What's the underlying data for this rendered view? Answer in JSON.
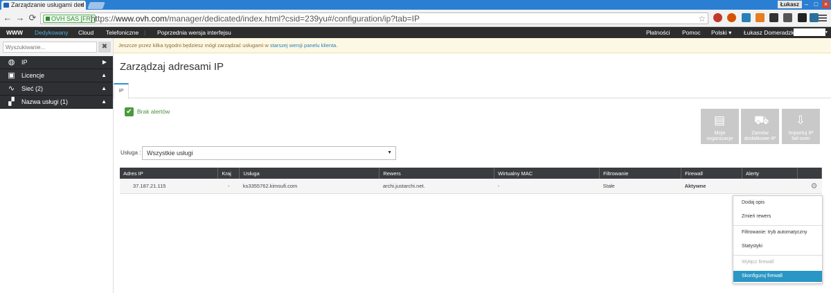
{
  "browser": {
    "tab_title": "Zarządzanie usługami ded",
    "tab_close": "×",
    "user_badge": "Łukasz",
    "ev_label": "OVH SAS [FR]",
    "url_scheme": "https://",
    "url_host": "www.ovh.com",
    "url_path": "/manager/dedicated/index.html?csid=239yu#/configuration/ip?tab=IP"
  },
  "topnav": {
    "www": "WWW",
    "dedicated": "Dedykowany",
    "cloud": "Cloud",
    "telephony": "Telefoniczne",
    "prev_version": "Poprzednia wersja interfejsu",
    "payments": "Płatności",
    "help": "Pomoc",
    "language": "Polski",
    "user": "Łukasz Domeradzki"
  },
  "sidebar": {
    "search_placeholder": "Wyszukiwanie...",
    "items": [
      {
        "label": "IP"
      },
      {
        "label": "Licencje"
      },
      {
        "label": "Sieć (2)"
      },
      {
        "label": "Nazwa usługi (1)"
      }
    ]
  },
  "notice": {
    "text": "Jeszcze przez kilka tygodni będziesz mógł zarządzać usługami w",
    "link": "starszej wersji panelu klienta."
  },
  "main": {
    "title": "Zarządzaj adresami IP",
    "tab": "IP",
    "alerts_label": "Brak alertów",
    "tiles": [
      {
        "line1": "Moje",
        "line2": "organizacje",
        "icon": "clipboard-icon"
      },
      {
        "line1": "Zamów",
        "line2": "dodatkowe IP",
        "icon": "cart-icon"
      },
      {
        "line1": "Importuj IP",
        "line2": "fail-over",
        "icon": "import-icon"
      }
    ],
    "service_label": "Usługa :",
    "service_value": "Wszystkie usługi"
  },
  "table": {
    "headers": [
      "Adres IP",
      "Kraj",
      "Usługa",
      "Rewers",
      "Wirtualny MAC",
      "Filtrowanie",
      "Firewall",
      "Alerty"
    ],
    "rows": [
      [
        "37.187.21.115",
        "-",
        "ks3355762.kimsufi.com",
        "archi.justarchi.net.",
        "-",
        "Stałe",
        "Aktywne",
        ""
      ]
    ]
  },
  "context_menu": {
    "items": [
      "Dodaj opis",
      "Zmień rewers",
      "Filtrowanie: tryb automatyczny",
      "Statystyki",
      "Wyłącz firewall",
      "Skonfiguruj firewall"
    ]
  },
  "colors": {
    "accent": "#2a96c5",
    "nav_bg": "#2d2d2d",
    "sidebar_bg": "#2f3034",
    "success": "#4a9a3c"
  }
}
